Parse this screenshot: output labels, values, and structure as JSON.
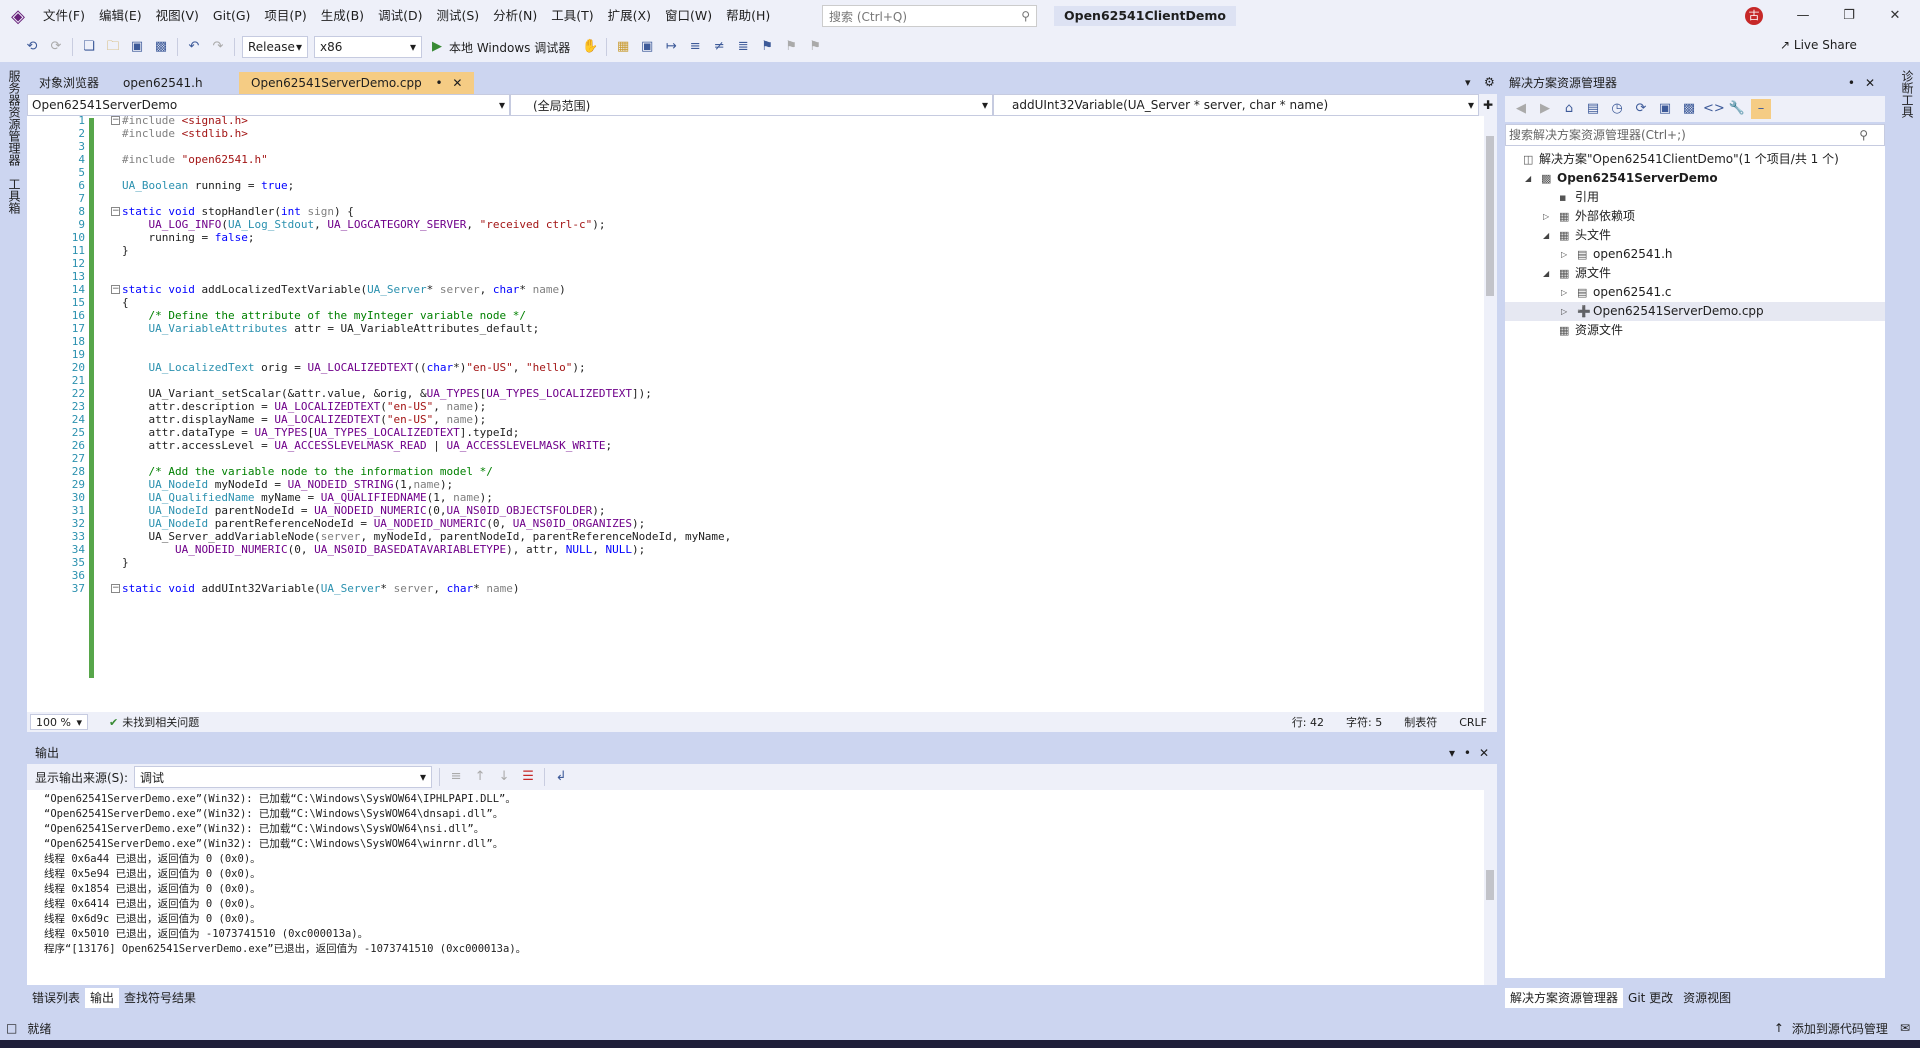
{
  "menu": {
    "items": [
      "文件(F)",
      "编辑(E)",
      "视图(V)",
      "Git(G)",
      "项目(P)",
      "生成(B)",
      "调试(D)",
      "测试(S)",
      "分析(N)",
      "工具(T)",
      "扩展(X)",
      "窗口(W)",
      "帮助(H)"
    ],
    "search_placeholder": "搜索 (Ctrl+Q)",
    "solution_title": "Open62541ClientDemo",
    "user_initial": "古"
  },
  "toolbar": {
    "config": "Release",
    "platform": "x86",
    "run_label": "本地 Windows 调试器",
    "live_share": "Live Share"
  },
  "left_strip": {
    "items": [
      "服务器资源管理器",
      "工具箱"
    ]
  },
  "right_strip": {
    "items": [
      "诊断工具"
    ]
  },
  "editor": {
    "tabs": [
      {
        "label": "对象浏览器"
      },
      {
        "label": "open62541.h"
      },
      {
        "label": "Open62541ServerDemo.cpp",
        "active": true
      }
    ],
    "nav": {
      "project": "Open62541ServerDemo",
      "scope": "(全局范围)",
      "member": "addUInt32Variable(UA_Server * server, char * name)"
    },
    "zoom": "100 %",
    "issues": "未找到相关问题",
    "line": "行: 42",
    "col": "字符: 5",
    "tabs_mode": "制表符",
    "eol": "CRLF"
  },
  "code_lines": [
    "#include <signal.h>",
    "#include <stdlib.h>",
    "",
    "#include \"open62541.h\"",
    "",
    "UA_Boolean running = true;",
    "",
    "static void stopHandler(int sign) {",
    "    UA_LOG_INFO(UA_Log_Stdout, UA_LOGCATEGORY_SERVER, \"received ctrl-c\");",
    "    running = false;",
    "}",
    "",
    "",
    "static void addLocalizedTextVariable(UA_Server* server, char* name)",
    "{",
    "    /* Define the attribute of the myInteger variable node */",
    "    UA_VariableAttributes attr = UA_VariableAttributes_default;",
    "",
    "",
    "    UA_LocalizedText orig = UA_LOCALIZEDTEXT((char*)\"en-US\", \"hello\");",
    "",
    "    UA_Variant_setScalar(&attr.value, &orig, &UA_TYPES[UA_TYPES_LOCALIZEDTEXT]);",
    "    attr.description = UA_LOCALIZEDTEXT(\"en-US\", name);",
    "    attr.displayName = UA_LOCALIZEDTEXT(\"en-US\", name);",
    "    attr.dataType = UA_TYPES[UA_TYPES_LOCALIZEDTEXT].typeId;",
    "    attr.accessLevel = UA_ACCESSLEVELMASK_READ | UA_ACCESSLEVELMASK_WRITE;",
    "",
    "    /* Add the variable node to the information model */",
    "    UA_NodeId myNodeId = UA_NODEID_STRING(1,name);",
    "    UA_QualifiedName myName = UA_QUALIFIEDNAME(1, name);",
    "    UA_NodeId parentNodeId = UA_NODEID_NUMERIC(0,UA_NS0ID_OBJECTSFOLDER);",
    "    UA_NodeId parentReferenceNodeId = UA_NODEID_NUMERIC(0, UA_NS0ID_ORGANIZES);",
    "    UA_Server_addVariableNode(server, myNodeId, parentNodeId, parentReferenceNodeId, myName,",
    "        UA_NODEID_NUMERIC(0, UA_NS0ID_BASEDATAVARIABLETYPE), attr, NULL, NULL);",
    "}",
    "",
    "static void addUInt32Variable(UA_Server* server, char* name)"
  ],
  "solution_explorer": {
    "title": "解决方案资源管理器",
    "search_placeholder": "搜索解决方案资源管理器(Ctrl+;)",
    "tree": [
      {
        "label": "解决方案\"Open62541ClientDemo\"(1 个项目/共 1 个)",
        "level": 0
      },
      {
        "label": "Open62541ServerDemo",
        "level": 1,
        "bold": true
      },
      {
        "label": "引用",
        "level": 2
      },
      {
        "label": "外部依赖项",
        "level": 2
      },
      {
        "label": "头文件",
        "level": 2
      },
      {
        "label": "open62541.h",
        "level": 3
      },
      {
        "label": "源文件",
        "level": 2
      },
      {
        "label": "open62541.c",
        "level": 3
      },
      {
        "label": "Open62541ServerDemo.cpp",
        "level": 3,
        "selected": true
      },
      {
        "label": "资源文件",
        "level": 2
      }
    ],
    "bottom_tabs": [
      "解决方案资源管理器",
      "Git 更改",
      "资源视图"
    ]
  },
  "output": {
    "title": "输出",
    "source_label": "显示输出来源(S):",
    "source_value": "调试",
    "lines": [
      "“Open62541ServerDemo.exe”(Win32): 已加载“C:\\Windows\\SysWOW64\\IPHLPAPI.DLL”。",
      "“Open62541ServerDemo.exe”(Win32): 已加载“C:\\Windows\\SysWOW64\\dnsapi.dll”。",
      "“Open62541ServerDemo.exe”(Win32): 已加载“C:\\Windows\\SysWOW64\\nsi.dll”。",
      "“Open62541ServerDemo.exe”(Win32): 已加载“C:\\Windows\\SysWOW64\\winrnr.dll”。",
      "线程 0x6a44 已退出，返回值为 0 (0x0)。",
      "线程 0x5e94 已退出，返回值为 0 (0x0)。",
      "线程 0x1854 已退出，返回值为 0 (0x0)。",
      "线程 0x6414 已退出，返回值为 0 (0x0)。",
      "线程 0x6d9c 已退出，返回值为 0 (0x0)。",
      "线程 0x5010 已退出，返回值为 -1073741510 (0xc000013a)。",
      "程序“[13176] Open62541ServerDemo.exe”已退出，返回值为 -1073741510 (0xc000013a)。"
    ],
    "bottom_tabs": [
      "错误列表",
      "输出",
      "查找符号结果"
    ]
  },
  "statusbar": {
    "left": "就绪",
    "right": "添加到源代码管理"
  }
}
